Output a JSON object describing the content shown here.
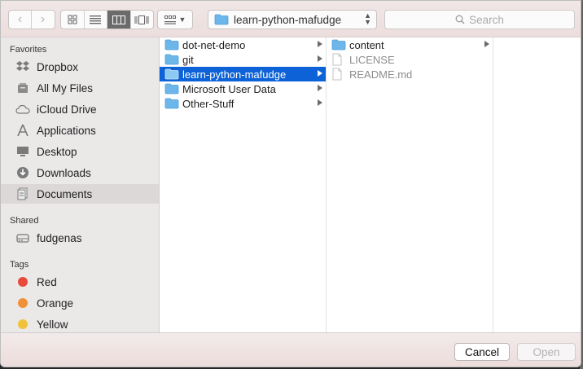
{
  "toolbar": {
    "path_folder": "learn-python-mafudge",
    "search_placeholder": "Search"
  },
  "sidebar": {
    "favorites_title": "Favorites",
    "favorites": [
      {
        "label": "Dropbox",
        "icon": "dropbox-icon"
      },
      {
        "label": "All My Files",
        "icon": "all-files-icon"
      },
      {
        "label": "iCloud Drive",
        "icon": "cloud-icon"
      },
      {
        "label": "Applications",
        "icon": "applications-icon"
      },
      {
        "label": "Desktop",
        "icon": "desktop-icon"
      },
      {
        "label": "Downloads",
        "icon": "downloads-icon"
      },
      {
        "label": "Documents",
        "icon": "documents-icon",
        "selected": true
      }
    ],
    "shared_title": "Shared",
    "shared": [
      {
        "label": "fudgenas",
        "icon": "server-icon"
      }
    ],
    "tags_title": "Tags",
    "tags": [
      {
        "label": "Red",
        "color": "#e84b3c"
      },
      {
        "label": "Orange",
        "color": "#f0913a"
      },
      {
        "label": "Yellow",
        "color": "#f0c23c"
      }
    ]
  },
  "column1": [
    {
      "label": "dot-net-demo",
      "type": "folder"
    },
    {
      "label": "git",
      "type": "folder"
    },
    {
      "label": "learn-python-mafudge",
      "type": "folder",
      "selected": true
    },
    {
      "label": "Microsoft User Data",
      "type": "folder"
    },
    {
      "label": "Other-Stuff",
      "type": "folder"
    }
  ],
  "column2": [
    {
      "label": "content",
      "type": "folder"
    },
    {
      "label": "LICENSE",
      "type": "file"
    },
    {
      "label": "README.md",
      "type": "file"
    }
  ],
  "buttons": {
    "cancel": "Cancel",
    "open": "Open"
  },
  "colors": {
    "selection": "#0c62d6",
    "folder": "#6db6ea"
  }
}
